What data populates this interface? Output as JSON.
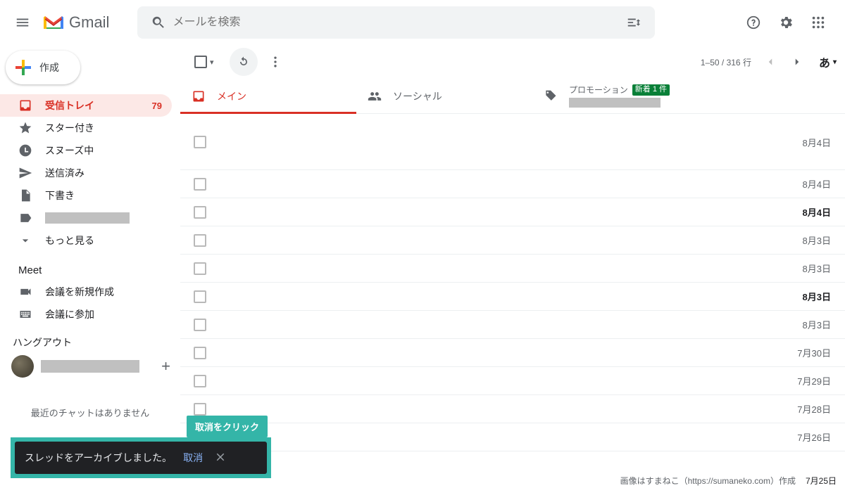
{
  "header": {
    "app_name": "Gmail",
    "search_placeholder": "メールを検索"
  },
  "compose_label": "作成",
  "sidebar": {
    "items": [
      {
        "label": "受信トレイ",
        "count": "79",
        "icon": "inbox"
      },
      {
        "label": "スター付き",
        "icon": "star"
      },
      {
        "label": "スヌーズ中",
        "icon": "clock"
      },
      {
        "label": "送信済み",
        "icon": "send"
      },
      {
        "label": "下書き",
        "icon": "file"
      },
      {
        "label": "",
        "icon": "label",
        "grey": true
      },
      {
        "label": "もっと見る",
        "icon": "expand"
      }
    ],
    "meet_header": "Meet",
    "meet_items": [
      "会議を新規作成",
      "会議に参加"
    ],
    "hangout_header": "ハングアウト",
    "no_chat": "最近のチャットはありません"
  },
  "toolbar": {
    "pager": "1–50 / 316 行",
    "lang": "あ"
  },
  "tabs": [
    {
      "label": "メイン",
      "kind": "primary",
      "active": true
    },
    {
      "label": "ソーシャル",
      "kind": "social"
    },
    {
      "label": "プロモーション",
      "kind": "promo",
      "badge": "新着 1 件"
    }
  ],
  "mails": [
    {
      "date": "8月4日",
      "unread": false,
      "tall": true
    },
    {
      "date": "8月4日",
      "unread": false
    },
    {
      "date": "8月4日",
      "unread": true
    },
    {
      "date": "8月3日",
      "unread": false
    },
    {
      "date": "8月3日",
      "unread": false
    },
    {
      "date": "8月3日",
      "unread": true
    },
    {
      "date": "8月3日",
      "unread": false
    },
    {
      "date": "7月30日",
      "unread": false
    },
    {
      "date": "7月29日",
      "unread": false
    },
    {
      "date": "7月28日",
      "unread": false
    },
    {
      "date": "7月26日",
      "unread": false
    }
  ],
  "callout": "取消をクリック",
  "toast": {
    "message": "スレッドをアーカイブしました。",
    "undo": "取消"
  },
  "footer": {
    "credit": "画像はすまねこ（https://sumaneko.com）作成",
    "date": "7月25日"
  }
}
